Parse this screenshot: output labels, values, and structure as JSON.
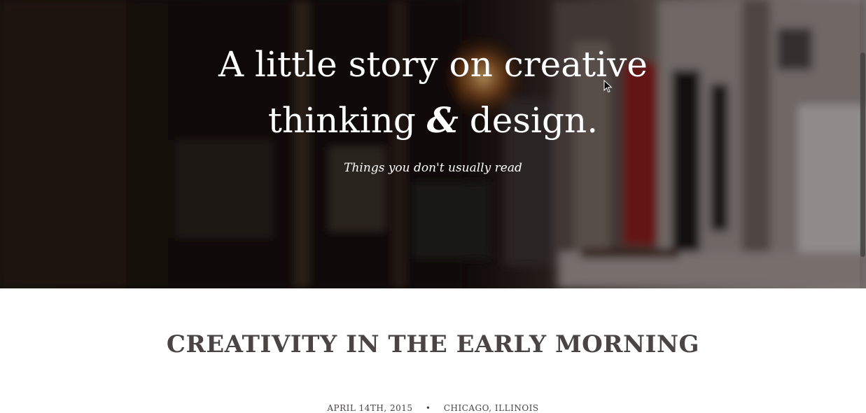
{
  "hero": {
    "title_line1": "A little story on creative",
    "title_line2_a": "thinking ",
    "title_amp": "&",
    "title_line2_b": " design.",
    "subtitle": "Things you don't usually read"
  },
  "post": {
    "title": "CREATIVITY IN THE EARLY MORNING",
    "date": "APRIL 14TH, 2015",
    "separator": "•",
    "location": "CHICAGO, ILLINOIS"
  },
  "colors": {
    "heading_text": "#4a4444",
    "hero_text": "#ffffff"
  },
  "icons": [
    "mouse-cursor-icon"
  ]
}
